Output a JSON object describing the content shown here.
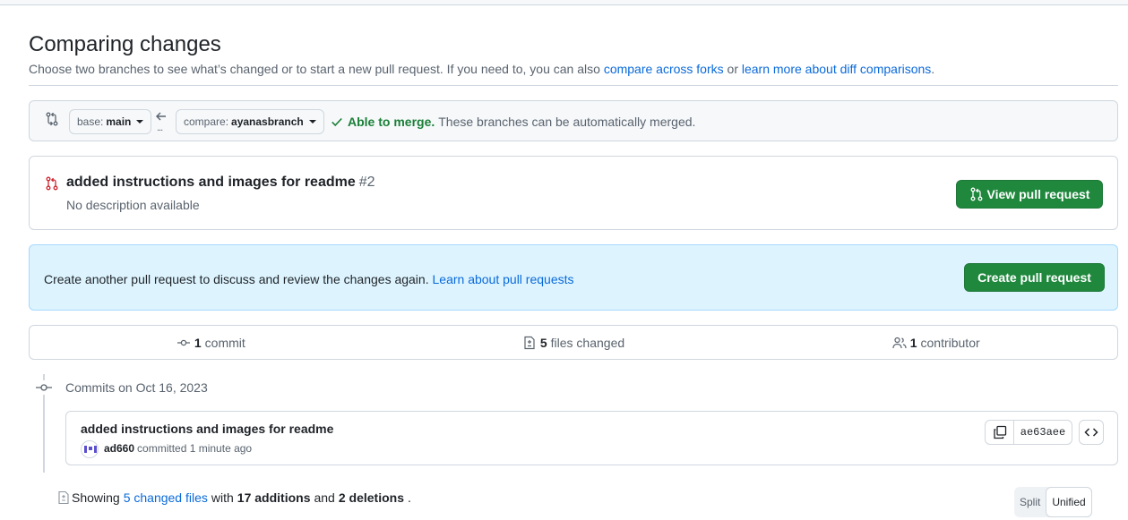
{
  "page": {
    "title": "Comparing changes",
    "subtitle_text": "Choose two branches to see what’s changed or to start a new pull request. If you need to, you can also",
    "subtitle_link1": "compare across forks",
    "subtitle_or": "or",
    "subtitle_link2": "learn more about diff comparisons",
    "subtitle_end": "."
  },
  "range": {
    "base_prefix": "base:",
    "base_branch": "main",
    "compare_prefix": "compare:",
    "compare_branch": "ayanasbranch",
    "dots": "...",
    "merge_status": "Able to merge.",
    "merge_detail": "These branches can be automatically merged."
  },
  "pull_request": {
    "title": "added instructions and images for readme",
    "number": "#2",
    "description": "No description available",
    "view_button": "View pull request"
  },
  "flash": {
    "text": "Create another pull request to discuss and review the changes again.",
    "link": "Learn about pull requests",
    "create_button": "Create pull request"
  },
  "stats": {
    "commits_count": "1",
    "commits_label": "commit",
    "files_count": "5",
    "files_label": "files changed",
    "contributors_count": "1",
    "contributors_label": "contributor"
  },
  "commits": {
    "date_header": "Commits on Oct 16, 2023",
    "items": [
      {
        "message": "added instructions and images for readme",
        "author": "ad660",
        "action": "committed 1 minute ago",
        "sha": "ae63aee"
      }
    ]
  },
  "summary": {
    "prefix": "Showing",
    "files_link": "5 changed files",
    "with": "with",
    "additions": "17 additions",
    "and": "and",
    "deletions": "2 deletions",
    "end": "."
  },
  "view_toggle": {
    "split": "Split",
    "unified": "Unified"
  },
  "colors": {
    "accent_link": "#0969da",
    "success": "#1a7f37",
    "button_green": "#1f883d",
    "pr_closed_red": "#cf222e",
    "flash_bg": "#ddf4ff"
  },
  "icons": {
    "compare": "git-compare-icon",
    "arrow": "arrow-left-icon",
    "check": "check-icon",
    "pr": "git-pull-request-icon",
    "commit": "git-commit-icon",
    "diff": "file-diff-icon",
    "people": "people-icon",
    "copy": "copy-icon",
    "code": "code-icon"
  }
}
